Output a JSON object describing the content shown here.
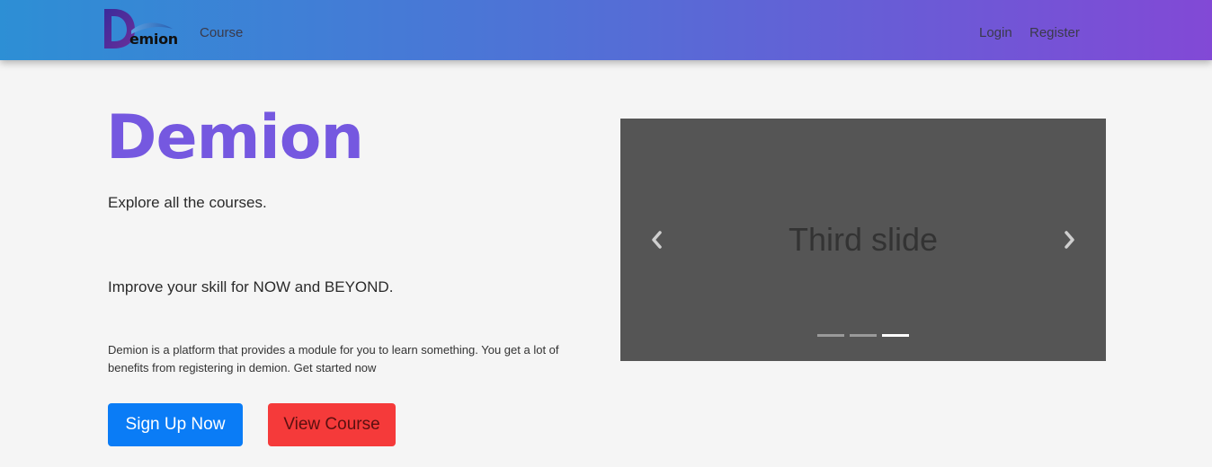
{
  "navbar": {
    "logo_text": "emion",
    "links": {
      "course": "Course",
      "login": "Login",
      "register": "Register"
    },
    "gradient_start": "#2d8fd5",
    "gradient_end": "#8249d6"
  },
  "hero": {
    "title": "Demion",
    "tagline_1": "Explore all the courses.",
    "tagline_2": "Improve your skill for NOW and BEYOND.",
    "description": "Demion is a platform that provides a module for you to learn something. You get a lot of benefits from registering in demion. Get started now",
    "signup_label": "Sign Up Now",
    "view_course_label": "View Course"
  },
  "carousel": {
    "slide_text": "Third slide",
    "prev_icon": "chevron-left-icon",
    "next_icon": "chevron-right-icon",
    "active_index": 3,
    "slide_count": 3
  },
  "colors": {
    "title": "#7558e0",
    "signup_button": "#0a7cf6",
    "view_course_button": "#f53a3a",
    "carousel_bg": "#555555"
  }
}
